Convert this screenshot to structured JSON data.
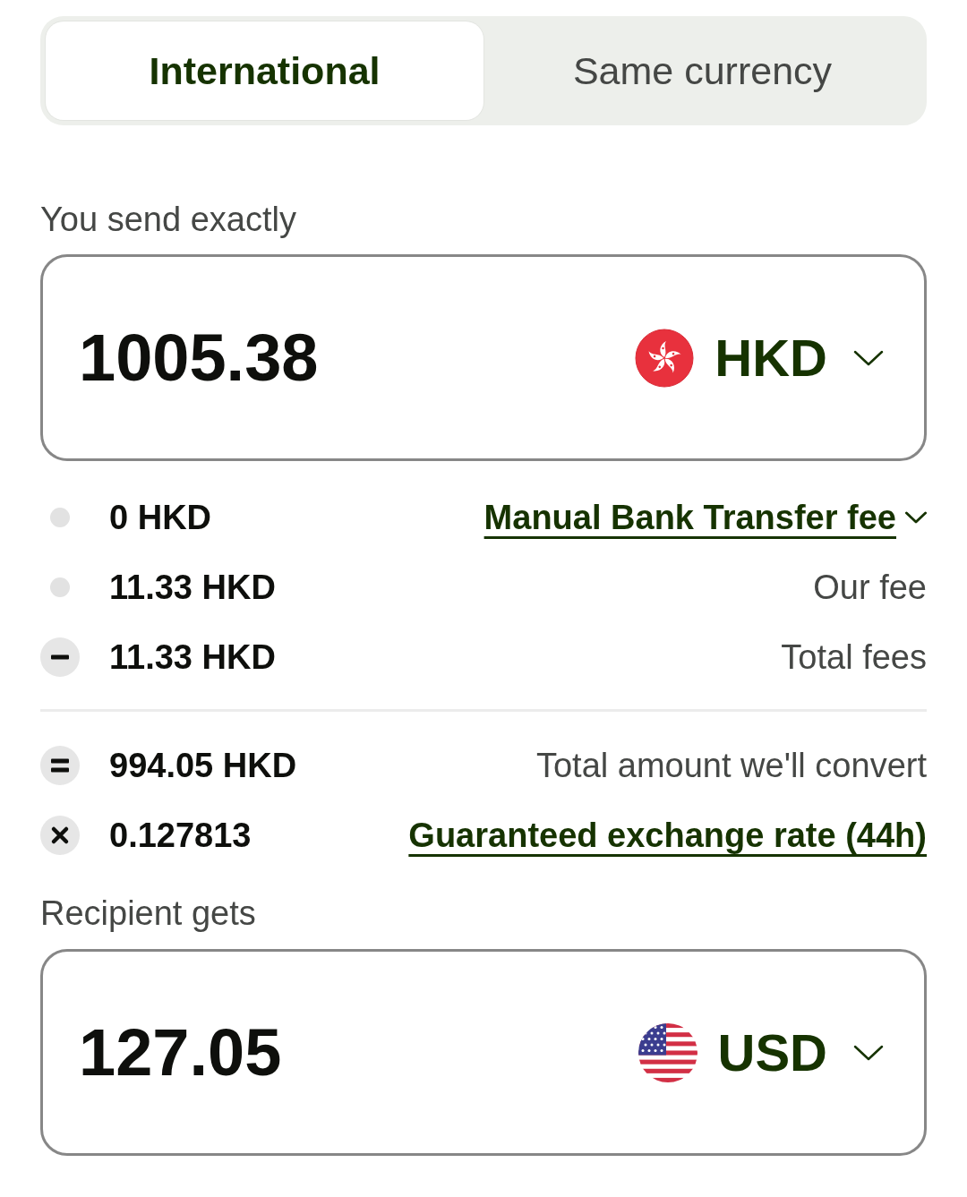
{
  "tabs": [
    {
      "label": "International",
      "selected": true
    },
    {
      "label": "Same currency",
      "selected": false
    }
  ],
  "send": {
    "label": "You send exactly",
    "amount": "1005.38",
    "currency": "HKD",
    "kind": "hk"
  },
  "fees": [
    {
      "kind": "dot",
      "amount": "0 HKD",
      "label": {
        "kind": "dropdown-link",
        "text": "Manual Bank Transfer fee"
      }
    },
    {
      "kind": "dot",
      "amount": "11.33 HKD",
      "label": {
        "kind": "text",
        "text": "Our fee"
      }
    },
    {
      "kind": "minus",
      "amount": "11.33 HKD",
      "label": {
        "kind": "text",
        "text": "Total fees"
      }
    }
  ],
  "conversion": [
    {
      "kind": "equals",
      "amount": "994.05 HKD",
      "label": {
        "kind": "text",
        "text": "Total amount we'll convert"
      }
    },
    {
      "kind": "times",
      "amount": "0.127813",
      "label": {
        "kind": "link",
        "text": "Guaranteed exchange rate (44h)"
      }
    }
  ],
  "receive": {
    "label": "Recipient gets",
    "amount": "127.05",
    "currency": "USD",
    "kind": "us"
  }
}
